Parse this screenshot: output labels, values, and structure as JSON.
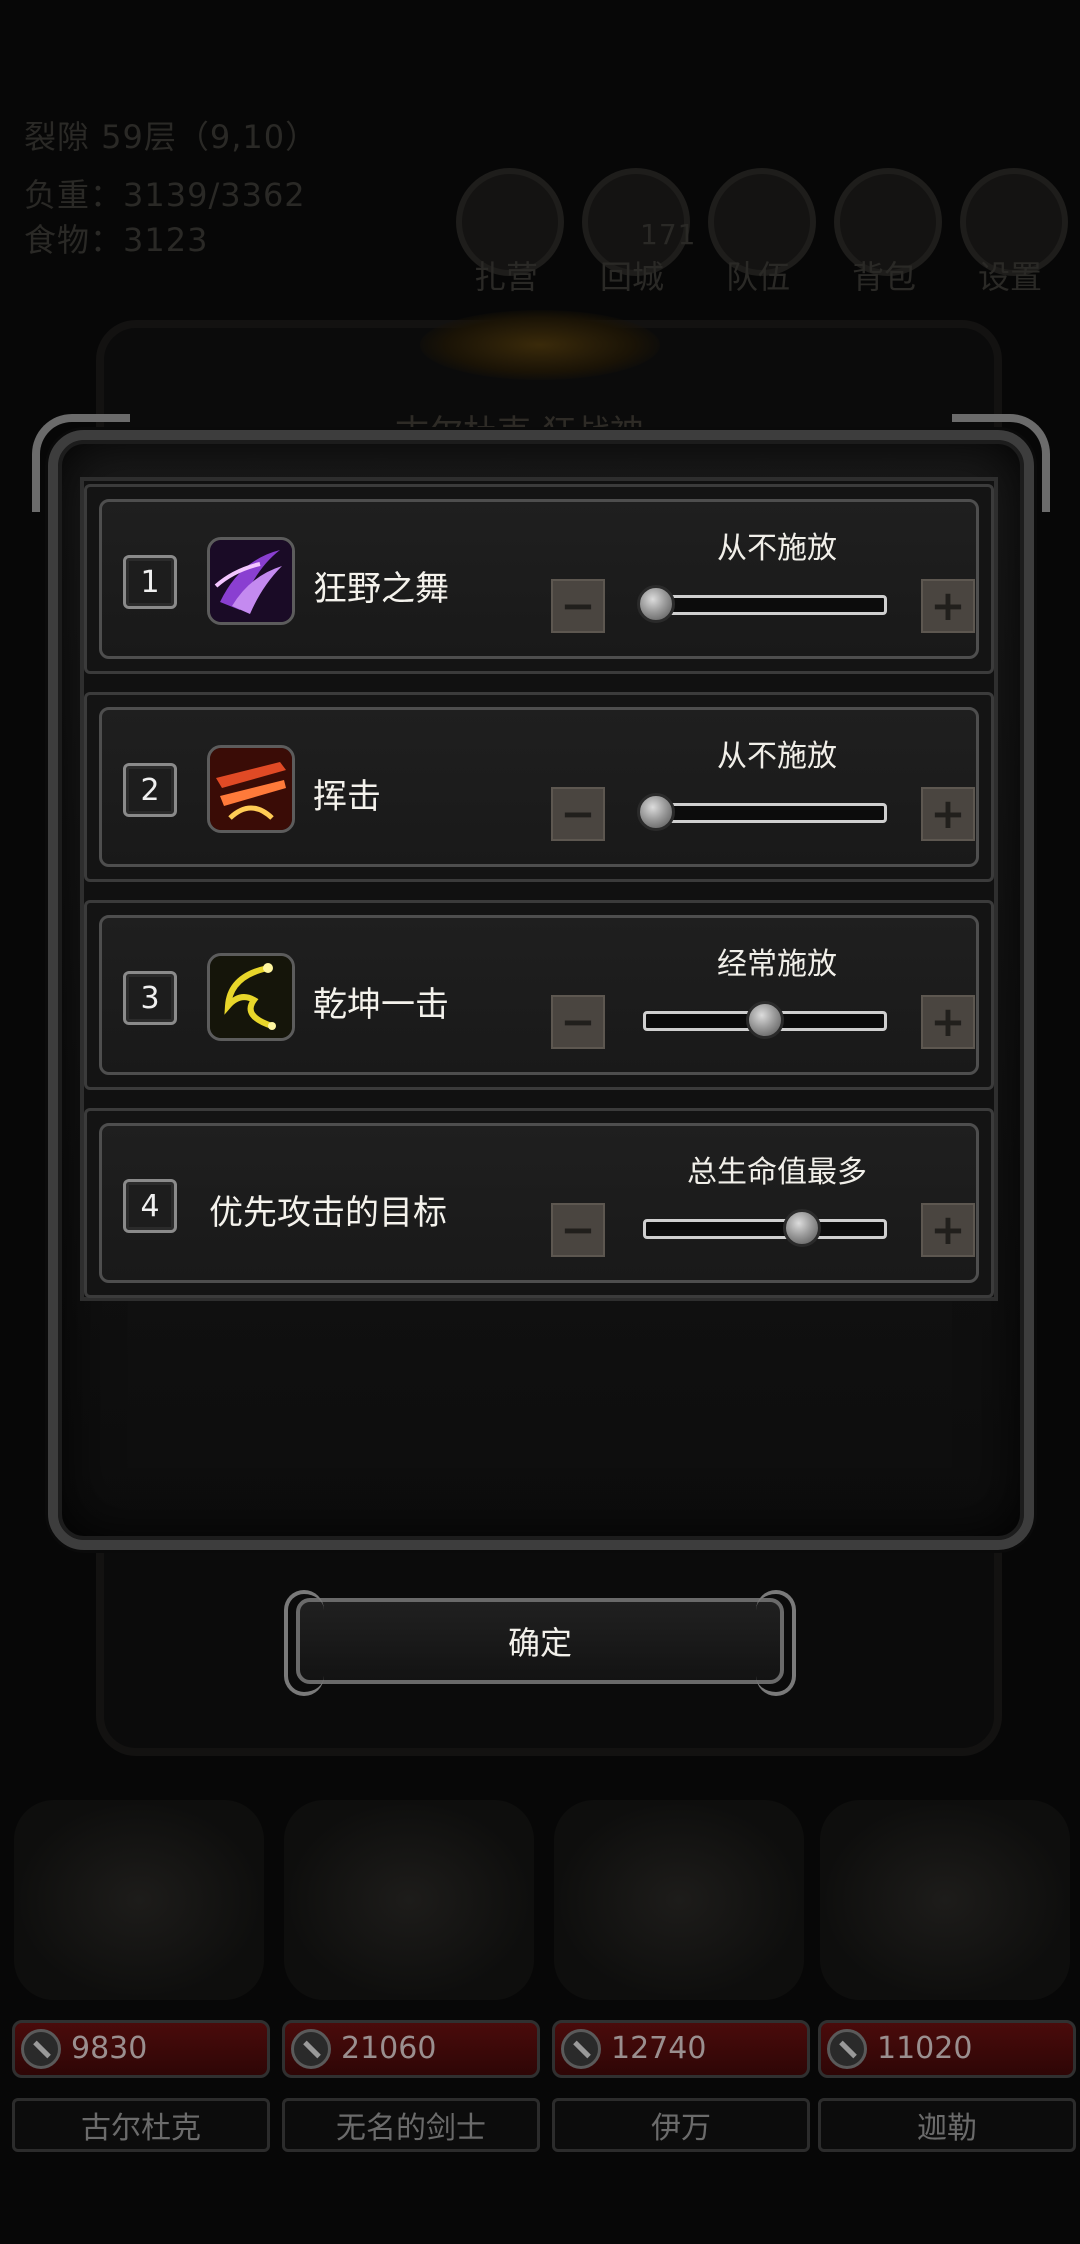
{
  "background": {
    "floor": "裂隙 59层（9,10）",
    "weight": "负重：3139/3362",
    "food": "食物：3123",
    "count": "171",
    "nav": [
      "扎营",
      "回城",
      "队伍",
      "背包",
      "设置"
    ],
    "subtitle": "古尔杜克 狂战神"
  },
  "skills": [
    {
      "number": "1",
      "name": "狂野之舞",
      "level": "从不施放",
      "level_fraction": 0.0,
      "icon": "wild-dance-icon",
      "icon_color": "#8a3fd1"
    },
    {
      "number": "2",
      "name": "挥击",
      "level": "从不施放",
      "level_fraction": 0.0,
      "icon": "swing-strike-icon",
      "icon_color": "#c2321b"
    },
    {
      "number": "3",
      "name": "乾坤一击",
      "level": "经常施放",
      "level_fraction": 0.5,
      "icon": "heaven-earth-strike-icon",
      "icon_color": "#d6c218"
    }
  ],
  "target": {
    "number": "4",
    "name": "优先攻击的目标",
    "level": "总生命值最多",
    "level_fraction": 0.67
  },
  "buttons": {
    "minus": "−",
    "plus": "+",
    "confirm": "确定"
  },
  "heroes": [
    {
      "hp": "9830",
      "name": "古尔杜克"
    },
    {
      "hp": "21060",
      "name": "无名的剑士"
    },
    {
      "hp": "12740",
      "name": "伊万"
    },
    {
      "hp": "11020",
      "name": "迦勒"
    }
  ]
}
